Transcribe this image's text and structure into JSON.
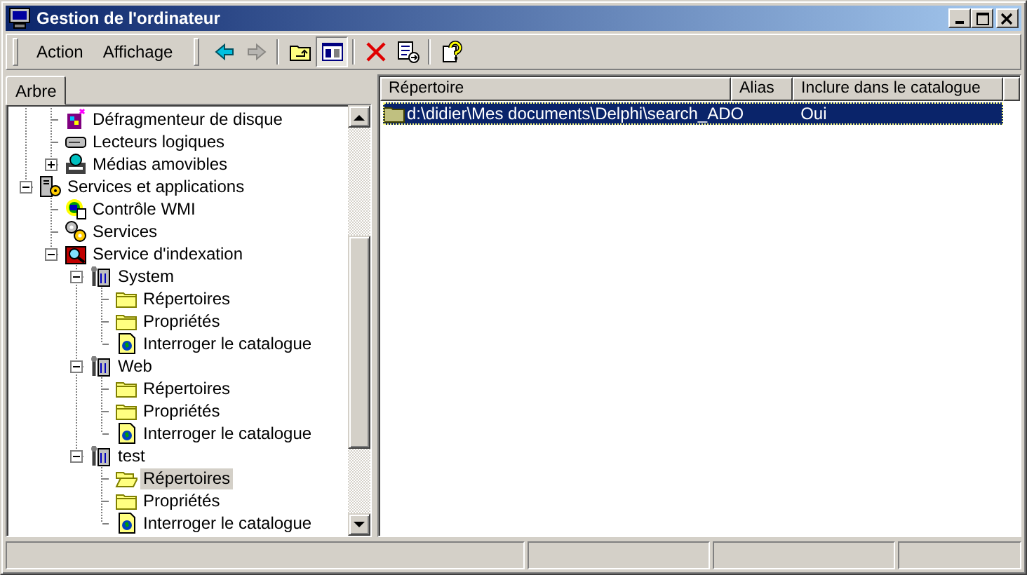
{
  "window": {
    "title": "Gestion de l'ordinateur"
  },
  "menu": [
    {
      "label": "Action"
    },
    {
      "label": "Affichage"
    }
  ],
  "toolbar": [
    {
      "kind": "back",
      "disabled": false,
      "pressed": false
    },
    {
      "kind": "forward",
      "disabled": true,
      "pressed": false
    },
    {
      "kind": "sep"
    },
    {
      "kind": "up-folder",
      "disabled": false,
      "pressed": false
    },
    {
      "kind": "show-tree",
      "disabled": false,
      "pressed": true
    },
    {
      "kind": "sep"
    },
    {
      "kind": "delete",
      "disabled": false,
      "pressed": false
    },
    {
      "kind": "export",
      "disabled": false,
      "pressed": false
    },
    {
      "kind": "sep"
    },
    {
      "kind": "help",
      "disabled": false,
      "pressed": false
    }
  ],
  "tabs": [
    {
      "label": "Arbre",
      "selected": true
    }
  ],
  "tree": {
    "items": [
      {
        "children": [
          {
            "label": "Défragmenteur de disque",
            "kind": "defrag"
          },
          {
            "label": "Lecteurs logiques",
            "kind": "drive"
          },
          {
            "label": "Médias amovibles",
            "kind": "media",
            "expanded": false,
            "has_children": true
          }
        ]
      },
      {
        "label": "Services et applications",
        "kind": "services-apps",
        "expanded": true,
        "children": [
          {
            "label": "Contrôle WMI",
            "kind": "wmi"
          },
          {
            "label": "Services",
            "kind": "gears"
          },
          {
            "label": "Service d'indexation",
            "kind": "indexing",
            "expanded": true,
            "children": [
              {
                "label": "System",
                "kind": "catalog",
                "expanded": true,
                "children": [
                  {
                    "label": "Répertoires",
                    "kind": "folder",
                    "selected": false
                  },
                  {
                    "label": "Propriétés",
                    "kind": "folder",
                    "selected": false
                  },
                  {
                    "label": "Interroger le catalogue",
                    "kind": "query",
                    "selected": false
                  }
                ]
              },
              {
                "label": "Web",
                "kind": "catalog",
                "expanded": true,
                "children": [
                  {
                    "label": "Répertoires",
                    "kind": "folder",
                    "selected": false
                  },
                  {
                    "label": "Propriétés",
                    "kind": "folder",
                    "selected": false
                  },
                  {
                    "label": "Interroger le catalogue",
                    "kind": "query",
                    "selected": false
                  }
                ]
              },
              {
                "label": "test",
                "kind": "catalog",
                "expanded": true,
                "children": [
                  {
                    "label": "Répertoires",
                    "kind": "folder-open",
                    "selected": true
                  },
                  {
                    "label": "Propriétés",
                    "kind": "folder",
                    "selected": false
                  },
                  {
                    "label": "Interroger le catalogue",
                    "kind": "query",
                    "selected": false
                  }
                ]
              }
            ]
          }
        ]
      }
    ]
  },
  "table": {
    "columns": [
      "Répertoire",
      "Alias",
      "Inclure dans le catalogue"
    ],
    "rows": [
      {
        "cells": [
          "d:\\didier\\Mes documents\\Delphi\\search_ADO",
          "",
          "Oui"
        ],
        "selected": true
      }
    ]
  }
}
